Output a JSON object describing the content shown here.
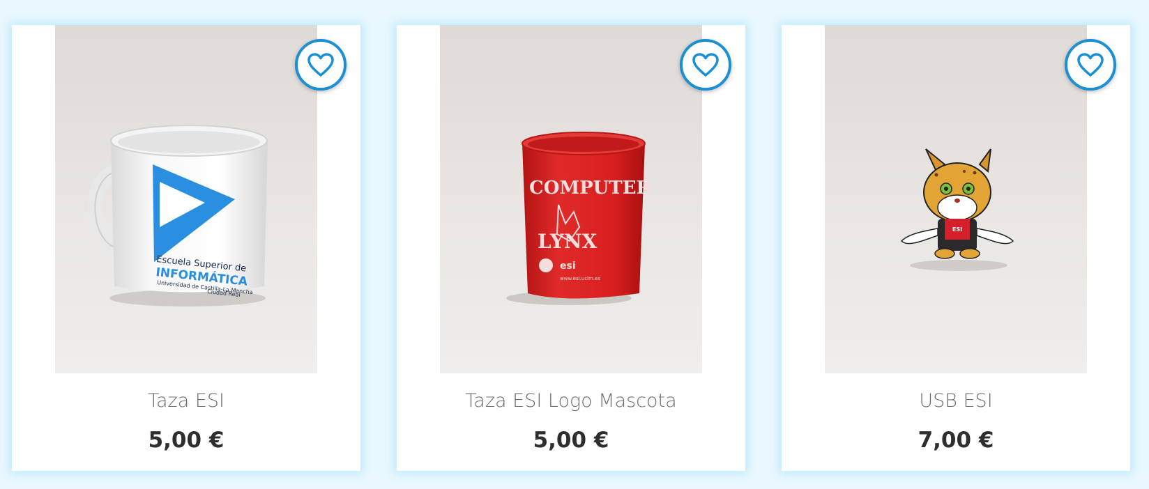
{
  "products": [
    {
      "name": "Taza ESI",
      "price": "5,00 €",
      "image_print": [
        "Escuela Superior de",
        "INFORMÁTICA",
        "Universidad de Castilla-La Mancha",
        "Ciudad Real"
      ]
    },
    {
      "name": "Taza ESI Logo Mascota",
      "price": "5,00 €",
      "image_print": [
        "COMPUTER",
        "LYNX",
        "esi",
        "www.esi.uclm.es"
      ]
    },
    {
      "name": "USB ESI",
      "price": "7,00 €",
      "image_print": [
        "ESI"
      ]
    }
  ],
  "icons": {
    "favorite": "heart-outline-icon"
  },
  "colors": {
    "accent": "#1a8fd4",
    "background": "#e9f7fe",
    "price_text": "#2e2e2e",
    "name_text": "#6d6d6d",
    "mug2": "#d81f1f"
  }
}
